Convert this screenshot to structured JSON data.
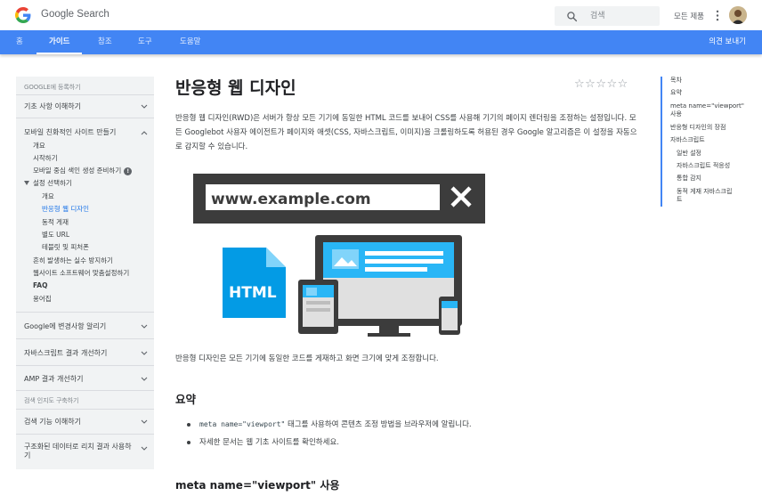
{
  "header": {
    "brand": "Google Search",
    "search_placeholder": "검색",
    "language": "모든 제품"
  },
  "nav": {
    "tabs": [
      {
        "label": "홈"
      },
      {
        "label": "가이드"
      },
      {
        "label": "참조"
      },
      {
        "label": "도구"
      },
      {
        "label": "도움말"
      }
    ],
    "feedback": "의견 보내기",
    "active_tab": "가이드"
  },
  "sidebar": {
    "heading1": "GOOGLE에 등록하기",
    "sec_basics": "기초 사항 이해하기",
    "sec_mobile": "모바일 친화적인 사이트 만들기",
    "mobile_items": [
      "개요",
      "시작하기",
      "모바일 중심 색인 생성 준비하기"
    ],
    "config_label": "설정 선택하기",
    "config_items": [
      "개요",
      "반응형 웹 디자인",
      "동적 게재",
      "별도 URL",
      "테블릿 및 피처폰"
    ],
    "more_items": [
      "흔히 발생하는 실수 방지하기",
      "웹사이트 소프트웨어 맞춤설정하기",
      "FAQ",
      "용어집"
    ],
    "sec_google": "Google에 변경사항 알리기",
    "sec_js": "자바스크립트 결과 개선하기",
    "sec_amp": "AMP 결과 개선하기",
    "heading2": "검색 인지도 구축하기",
    "sec_search": "검색 기능 이해하기",
    "sec_structured": "구조화된 데이터로 리치 결과 사용하기"
  },
  "main": {
    "title": "반응형 웹 디자인",
    "intro": "반응형 웹 디자인(RWD)은 서버가 항상 모든 기기에 동일한 HTML 코드를 보내어 CSS를 사용해 기기의 페이지 렌더링을 조정하는 설정입니다. 모든 Googlebot 사용자 에이전트가 페이지와 애셋(CSS, 자바스크립트, 이미지)을 크롤링하도록 허용된 경우 Google 알고리즘은 이 설정을 자동으로 감지할 수 있습니다.",
    "hero_url": "www.example.com",
    "hero_html_label": "HTML",
    "desc": "반응형 디자인은 모든 기기에 동일한 코드를 게재하고 화면 크기에 맞게 조정합니다.",
    "summary_heading": "요약",
    "bullet1_code": "meta name=\"viewport\"",
    "bullet1_text": " 태그를 사용하여 콘텐츠 조정 방법을 브라우저에 알립니다.",
    "bullet2": "자세한 문서는 웹 기초 사이트를 확인하세요.",
    "section_heading": "meta name=\"viewport\" 사용"
  },
  "toc": {
    "items": [
      "목차",
      "요약",
      "meta name=\"viewport\"",
      "사용",
      "반응형 디자인의 장점",
      "자바스크립트",
      "일반 설정",
      "자바스크립트 적응성",
      "통합 감지",
      "동적 게재 자바스크립",
      "트"
    ]
  },
  "colors": {
    "nav_blue": "#4285f4",
    "link_blue": "#1a73e8",
    "hero_dark": "#3c3c3c",
    "hero_blue": "#039be5"
  }
}
